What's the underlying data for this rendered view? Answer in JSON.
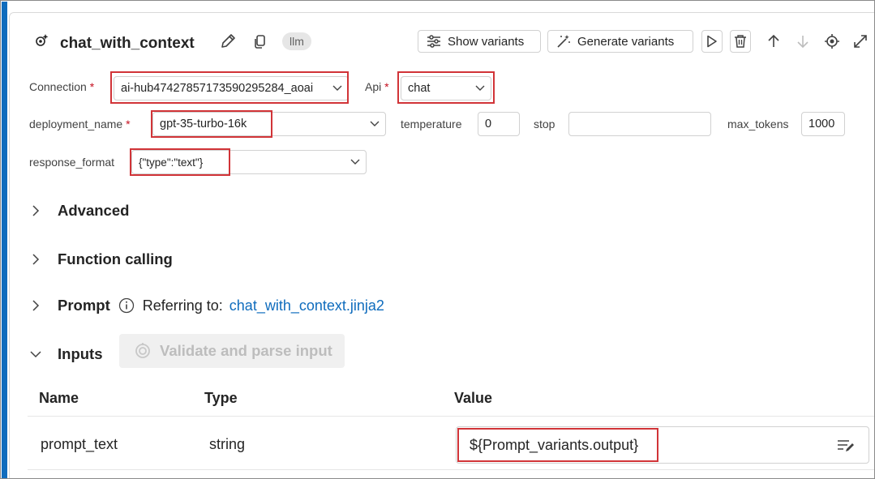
{
  "node": {
    "title": "chat_with_context",
    "type_badge": "llm",
    "toolbar": {
      "show_variants_label": "Show variants",
      "generate_variants_label": "Generate variants"
    }
  },
  "form": {
    "connection": {
      "label": "Connection",
      "required_mark": "*",
      "value": "ai-hub4742785717359029528​4_aoai"
    },
    "api": {
      "label": "Api",
      "required_mark": "*",
      "value": "chat"
    },
    "deployment_name": {
      "label": "deployment_name",
      "required_mark": "*",
      "value": "gpt-35-turbo-16k"
    },
    "temperature": {
      "label": "temperature",
      "value": "0"
    },
    "stop": {
      "label": "stop",
      "value": ""
    },
    "max_tokens": {
      "label": "max_tokens",
      "value": "1000"
    },
    "response_format": {
      "label": "response_format",
      "value": "{\"type\":\"text\"}"
    }
  },
  "sections": {
    "advanced": "Advanced",
    "function_calling": "Function calling",
    "prompt": {
      "label": "Prompt",
      "referring_label": "Referring to:",
      "file_link": "chat_with_context.jinja2"
    },
    "inputs": {
      "label": "Inputs",
      "validate_button": "Validate and parse input"
    }
  },
  "inputs_table": {
    "columns": [
      "Name",
      "Type",
      "Value"
    ],
    "rows": [
      {
        "name": "prompt_text",
        "type": "string",
        "value": "${Prompt_variants.output}"
      }
    ]
  },
  "colors": {
    "accent": "#0f6cbd",
    "highlight_box": "#d13438",
    "required": "#c50f1f",
    "link": "#0f6cbd"
  }
}
